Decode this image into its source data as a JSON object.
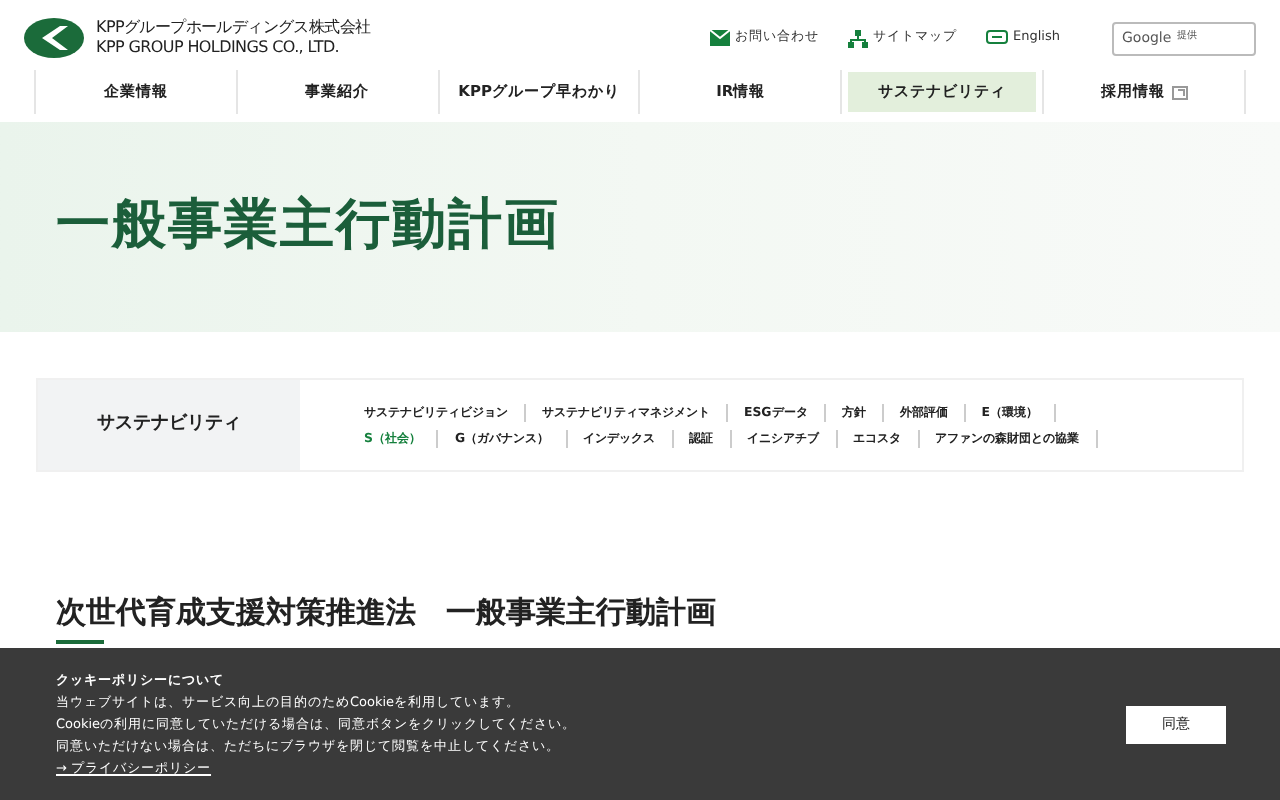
{
  "logo": {
    "line1": "KPPグループホールディングス株式会社",
    "line2": "KPP GROUP HOLDINGS CO., LTD."
  },
  "utility_links": [
    {
      "kind": "mail",
      "label": "お問い合わせ"
    },
    {
      "kind": "sitemap",
      "label": "サイトマップ"
    },
    {
      "kind": "language",
      "label": "English"
    }
  ],
  "search": {
    "brand": "Google",
    "note": "提供"
  },
  "nav": [
    {
      "label": "企業情報",
      "selected": false,
      "external": false
    },
    {
      "label": "事業紹介",
      "selected": false,
      "external": false
    },
    {
      "label": "KPPグループ早わかり",
      "selected": false,
      "external": false
    },
    {
      "label": "IR情報",
      "selected": false,
      "external": false
    },
    {
      "label": "サステナビリティ",
      "selected": true,
      "external": false
    },
    {
      "label": "採用情報",
      "selected": false,
      "external": true
    }
  ],
  "hero": {
    "title": "一般事業主行動計画"
  },
  "subnav": {
    "title": "サステナビリティ",
    "links": [
      {
        "label": "サステナビリティビジョン",
        "selected": false
      },
      {
        "label": "サステナビリティマネジメント",
        "selected": false
      },
      {
        "label": "ESGデータ",
        "selected": false
      },
      {
        "label": "方針",
        "selected": false
      },
      {
        "label": "外部評価",
        "selected": false
      },
      {
        "label": "E（環境）",
        "selected": false
      },
      {
        "label": "S（社会）",
        "selected": true
      },
      {
        "label": "G（ガバナンス）",
        "selected": false
      },
      {
        "label": "インデックス",
        "selected": false
      },
      {
        "label": "認証",
        "selected": false
      },
      {
        "label": "イニシアチブ",
        "selected": false
      },
      {
        "label": "エコスタ",
        "selected": false
      },
      {
        "label": "アファンの森財団との協業",
        "selected": false
      }
    ]
  },
  "section": {
    "title": "次世代育成支援対策推進法　一般事業主行動計画"
  },
  "cookie_banner": {
    "title": "クッキーポリシーについて",
    "lines": [
      "当ウェブサイトは、サービス向上の目的のためCookieを利用しています。",
      "Cookieの利用に同意していただける場合は、同意ボタンをクリックしてください。",
      "同意いただけない場合は、ただちにブラウザを閉じて閲覧を中止してください。"
    ],
    "link": "→ プライバシーポリシー",
    "button": "同意"
  }
}
